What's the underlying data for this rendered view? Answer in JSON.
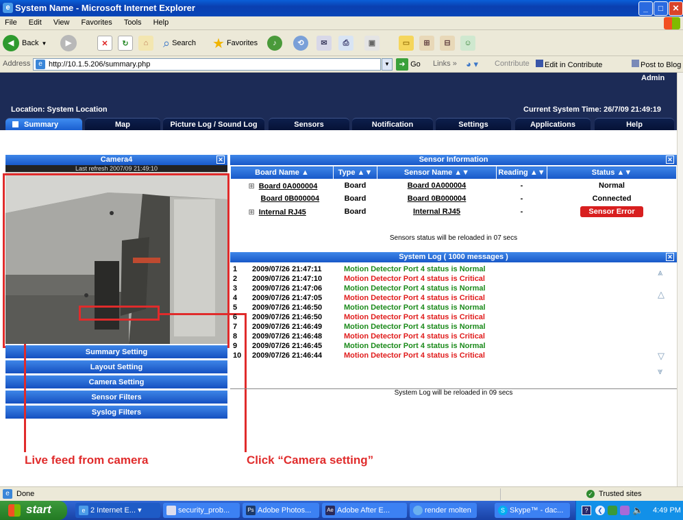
{
  "window": {
    "title": "System Name - Microsoft Internet Explorer"
  },
  "menu": [
    "File",
    "Edit",
    "View",
    "Favorites",
    "Tools",
    "Help"
  ],
  "toolbar": {
    "back": "Back",
    "search": "Search",
    "favorites": "Favorites"
  },
  "address": {
    "label": "Address",
    "url": "http://10.1.5.206/summary.php",
    "go": "Go",
    "links": "Links",
    "contribute": "Contribute",
    "edit_in_contribute": "Edit in Contribute",
    "post_to_blog": "Post to Blog"
  },
  "header": {
    "user": "Admin",
    "location": "Location: System Location",
    "time": "Current System Time: 26/7/09 21:49:19"
  },
  "tabs": [
    "Summary",
    "Map",
    "Picture Log / Sound Log",
    "Sensors",
    "Notification",
    "Settings",
    "Applications",
    "Help"
  ],
  "camera": {
    "title": "Camera4",
    "refresh": "Last refresh 2007/09 21:49:10"
  },
  "side_buttons": [
    "Summary Setting",
    "Layout Setting",
    "Camera Setting",
    "Sensor Filters",
    "Syslog Filters"
  ],
  "sensor_info": {
    "title": "Sensor Information",
    "columns": [
      "Board Name ▲",
      "Type ▲▼",
      "Sensor Name ▲▼",
      "Reading ▲▼",
      "Status ▲▼"
    ],
    "rows": [
      {
        "board": "Board 0A000004",
        "type": "Board",
        "sensor": "Board 0A000004",
        "reading": "-",
        "status": "Normal"
      },
      {
        "board": "Board 0B000004",
        "type": "Board",
        "sensor": "Board 0B000004",
        "reading": "-",
        "status": "Connected"
      },
      {
        "board": "Internal RJ45",
        "type": "Board",
        "sensor": "Internal RJ45",
        "reading": "-",
        "status": "Sensor Error"
      }
    ],
    "reload": "Sensors status will be reloaded in 07 secs"
  },
  "syslog": {
    "title": "System Log ( 1000 messages )",
    "rows": [
      {
        "n": "1",
        "time": "2009/07/26 21:47:11",
        "msg": "Motion Detector Port 4 status is Normal"
      },
      {
        "n": "2",
        "time": "2009/07/26 21:47:10",
        "msg": "Motion Detector Port 4 status is Critical"
      },
      {
        "n": "3",
        "time": "2009/07/26 21:47:06",
        "msg": "Motion Detector Port 4 status is Normal"
      },
      {
        "n": "4",
        "time": "2009/07/26 21:47:05",
        "msg": "Motion Detector Port 4 status is Critical"
      },
      {
        "n": "5",
        "time": "2009/07/26 21:46:50",
        "msg": "Motion Detector Port 4 status is Normal"
      },
      {
        "n": "6",
        "time": "2009/07/26 21:46:50",
        "msg": "Motion Detector Port 4 status is Critical"
      },
      {
        "n": "7",
        "time": "2009/07/26 21:46:49",
        "msg": "Motion Detector Port 4 status is Normal"
      },
      {
        "n": "8",
        "time": "2009/07/26 21:46:48",
        "msg": "Motion Detector Port 4 status is Critical"
      },
      {
        "n": "9",
        "time": "2009/07/26 21:46:45",
        "msg": "Motion Detector Port 4 status is Normal"
      },
      {
        "n": "10",
        "time": "2009/07/26 21:46:44",
        "msg": "Motion Detector Port 4 status is Critical"
      }
    ],
    "reload": "System Log will be reloaded in 09 secs"
  },
  "annotations": {
    "live": "Live feed from camera",
    "click": "Click “Camera setting”"
  },
  "status": {
    "done": "Done",
    "zone": "Trusted sites"
  },
  "taskbar": {
    "start": "start",
    "tasks": [
      "2 Internet E...",
      "security_prob...",
      "Adobe Photos...",
      "Adobe After E...",
      "render molten",
      "Skype™ - dac..."
    ],
    "clock": "4:49 PM"
  },
  "colors": {
    "accent": "#1858c8",
    "header_bg": "#1c2b56",
    "normal": "#1a8a1a",
    "critical": "#e01b1b",
    "annotation": "#e02b2b"
  }
}
